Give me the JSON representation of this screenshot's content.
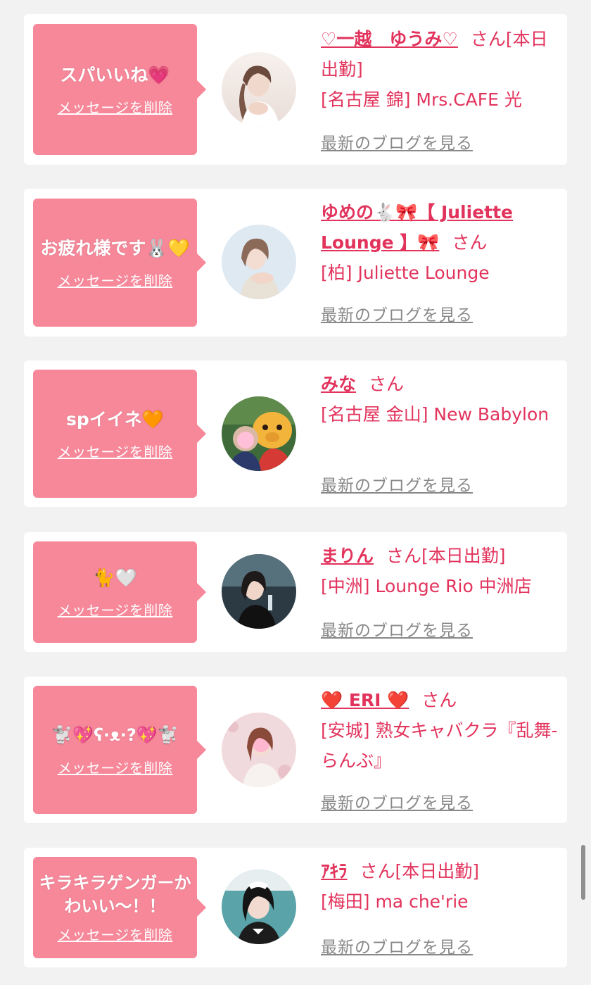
{
  "colors": {
    "bubble": "#f6889a",
    "accent": "#e2335c",
    "link_gray": "#888888",
    "background": "#f2f2f2"
  },
  "entries": [
    {
      "message": "スパいいね💗",
      "delete_label": "メッセージを削除",
      "name": "♡一越　ゆうみ♡",
      "san": "さん",
      "status": "[本日出勤]",
      "shop": "[名古屋 錦] Mrs.CAFE 光",
      "blog_label": "最新のブログを見る"
    },
    {
      "message": "お疲れ様です🐰💛",
      "delete_label": "メッセージを削除",
      "name": "ゆめの🐇🎀【 Juliette Lounge 】🎀",
      "san": "さん",
      "status": "",
      "shop": "[柏] Juliette Lounge",
      "blog_label": "最新のブログを見る"
    },
    {
      "message": "spイイネ🧡",
      "delete_label": "メッセージを削除",
      "name": "みな",
      "san": "さん",
      "status": "",
      "shop": "[名古屋 金山] New Babylon",
      "blog_label": "最新のブログを見る"
    },
    {
      "message": "🐈🤍",
      "delete_label": "メッセージを削除",
      "name": "まりん",
      "san": "さん",
      "status": "[本日出勤]",
      "shop": "[中洲] Lounge Rio 中洲店",
      "blog_label": "最新のブログを見る"
    },
    {
      "message": "🐩💖ʕ·ᴥ·?💖🐩",
      "delete_label": "メッセージを削除",
      "name": "❤️ ERI ❤️",
      "san": "さん",
      "status": "",
      "shop": "[安城] 熟女キャバクラ『乱舞-らんぶ』",
      "blog_label": "最新のブログを見る"
    },
    {
      "message": "キラキラゲンガーかわいい〜！！",
      "delete_label": "メッセージを削除",
      "name": "ｱｷﾗ",
      "san": "さん",
      "status": "[本日出勤]",
      "shop": "[梅田] ma che'rie",
      "blog_label": "最新のブログを見る"
    }
  ]
}
